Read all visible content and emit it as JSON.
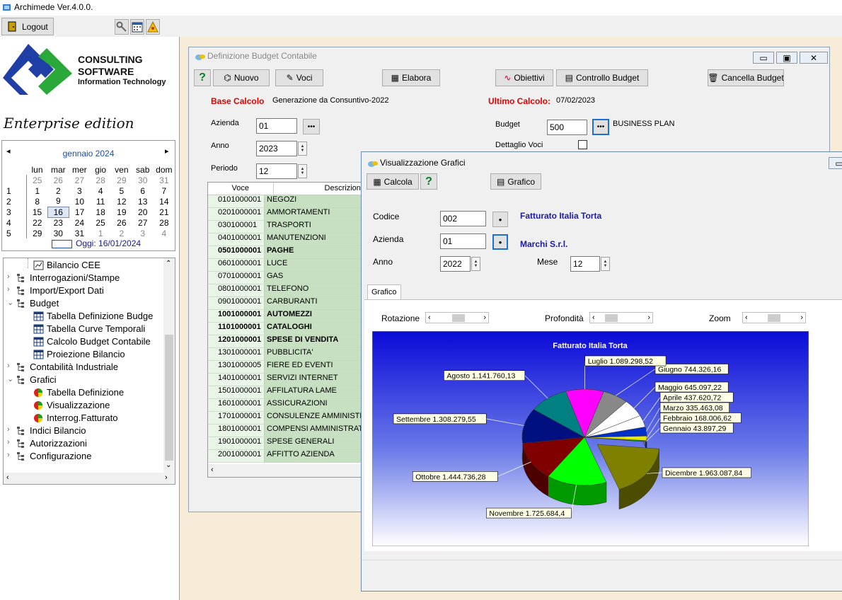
{
  "app": {
    "title": "Archimede Ver.4.0.0.",
    "logout": "Logout"
  },
  "logo": {
    "line1": "CONSULTING",
    "line2": "SOFTWARE",
    "line3": "Information Technology",
    "edition": "Enterprise edition"
  },
  "calendar": {
    "month": "gennaio 2024",
    "weekdays": [
      "lun",
      "mar",
      "mer",
      "gio",
      "ven",
      "sab",
      "dom"
    ],
    "weeks": [
      {
        "wk": "",
        "days": [
          "25",
          "26",
          "27",
          "28",
          "29",
          "30",
          "31"
        ]
      },
      {
        "wk": "1",
        "days": [
          "1",
          "2",
          "3",
          "4",
          "5",
          "6",
          "7"
        ]
      },
      {
        "wk": "2",
        "days": [
          "8",
          "9",
          "10",
          "11",
          "12",
          "13",
          "14"
        ]
      },
      {
        "wk": "3",
        "days": [
          "15",
          "16",
          "17",
          "18",
          "19",
          "20",
          "21"
        ]
      },
      {
        "wk": "4",
        "days": [
          "22",
          "23",
          "24",
          "25",
          "26",
          "27",
          "28"
        ]
      },
      {
        "wk": "5",
        "days": [
          "29",
          "30",
          "31",
          "1",
          "2",
          "3",
          "4"
        ]
      }
    ],
    "today": "Oggi: 16/01/2024"
  },
  "tree": [
    {
      "label": "Bilancio CEE",
      "level": 2,
      "icon": "report-icon"
    },
    {
      "label": "Interrogazioni/Stampe",
      "level": 0,
      "icon": "folder-tree-icon",
      "exp": "›"
    },
    {
      "label": "Import/Export Dati",
      "level": 0,
      "icon": "folder-tree-icon",
      "exp": "›"
    },
    {
      "label": "Budget",
      "level": 0,
      "icon": "folder-tree-icon",
      "exp": "⌄"
    },
    {
      "label": "Tabella Definizione Budge",
      "level": 1,
      "icon": "table-icon"
    },
    {
      "label": "Tabella Curve Temporali",
      "level": 1,
      "icon": "table-icon"
    },
    {
      "label": "Calcolo Budget Contabile",
      "level": 1,
      "icon": "table-icon"
    },
    {
      "label": "Proiezione Bilancio",
      "level": 1,
      "icon": "table-icon"
    },
    {
      "label": "Contabilità Industriale",
      "level": 0,
      "icon": "folder-tree-icon",
      "exp": "›"
    },
    {
      "label": "Grafici",
      "level": 0,
      "icon": "folder-tree-icon",
      "exp": "⌄"
    },
    {
      "label": "Tabella Definizione",
      "level": 1,
      "icon": "pie-chart-icon"
    },
    {
      "label": "Visualizzazione",
      "level": 1,
      "icon": "pie-chart-icon"
    },
    {
      "label": "Interrog.Fatturato",
      "level": 1,
      "icon": "pie-chart-icon"
    },
    {
      "label": "Indici Bilancio",
      "level": 0,
      "icon": "folder-tree-icon",
      "exp": "›"
    },
    {
      "label": "Autorizzazioni",
      "level": 0,
      "icon": "folder-tree-icon",
      "exp": "›"
    },
    {
      "label": "Configurazione",
      "level": 0,
      "icon": "folder-tree-icon",
      "exp": "›"
    }
  ],
  "budget_win": {
    "title": "Definizione Budget Contabile",
    "buttons": {
      "nuovo": "Nuovo",
      "voci": "Voci",
      "elabora": "Elabora",
      "obiettivi": "Obiettivi",
      "controllo": "Controllo Budget",
      "cancella": "Cancella Budget"
    },
    "base_label": "Base Calcolo",
    "base_value": "Generazione da Consuntivo-2022",
    "ultimo_label": "Ultimo Calcolo:",
    "ultimo_value": "07/02/2023",
    "azienda_label": "Azienda",
    "azienda": "01",
    "anno_label": "Anno",
    "anno": "2023",
    "periodo_label": "Periodo",
    "periodo": "12",
    "budget_label": "Budget",
    "budget": "500",
    "budget_desc": "BUSINESS PLAN",
    "dettaglio_label": "Dettaglio Voci",
    "grid_headers": [
      "Voce",
      "Descrizione"
    ],
    "rows": [
      {
        "code": "0101000001",
        "desc": "NEGOZI",
        "bold": false
      },
      {
        "code": "0201000001",
        "desc": "AMMORTAMENTI",
        "bold": false
      },
      {
        "code": "030100001",
        "desc": "TRASPORTI",
        "bold": false
      },
      {
        "code": "0401000001",
        "desc": "MANUTENZIONI",
        "bold": false
      },
      {
        "code": "0501000001",
        "desc": "PAGHE",
        "bold": true
      },
      {
        "code": "0601000001",
        "desc": "LUCE",
        "bold": false
      },
      {
        "code": "0701000001",
        "desc": "GAS",
        "bold": false
      },
      {
        "code": "0801000001",
        "desc": "TELEFONO",
        "bold": false
      },
      {
        "code": "0901000001",
        "desc": "CARBURANTI",
        "bold": false
      },
      {
        "code": "1001000001",
        "desc": "AUTOMEZZI",
        "bold": true
      },
      {
        "code": "1101000001",
        "desc": "CATALOGHI",
        "bold": true
      },
      {
        "code": "1201000001",
        "desc": "SPESE DI VENDITA",
        "bold": true
      },
      {
        "code": "1301000001",
        "desc": "PUBBLICITA'",
        "bold": false
      },
      {
        "code": "1301000005",
        "desc": "FIERE ED EVENTI",
        "bold": false
      },
      {
        "code": "1401000001",
        "desc": "SERVIZI INTERNET",
        "bold": false
      },
      {
        "code": "1501000001",
        "desc": "AFFILATURA LAME",
        "bold": false
      },
      {
        "code": "1601000001",
        "desc": "ASSICURAZIONI",
        "bold": false
      },
      {
        "code": "1701000001",
        "desc": "CONSULENZE AMMINISTR",
        "bold": false
      },
      {
        "code": "1801000001",
        "desc": "COMPENSI AMMINISTRAT",
        "bold": false
      },
      {
        "code": "1901000001",
        "desc": "SPESE GENERALI",
        "bold": false
      },
      {
        "code": "2001000001",
        "desc": "AFFITTO AZIENDA",
        "bold": false
      }
    ]
  },
  "grafici_win": {
    "title": "Visualizzazione Grafici",
    "calcola": "Calcola",
    "grafico_btn": "Grafico",
    "codice_label": "Codice",
    "codice": "002",
    "codice_desc": "Fatturato Italia Torta",
    "azienda_label": "Azienda",
    "azienda": "01",
    "azienda_desc": "Marchi S.r.l.",
    "anno_label": "Anno",
    "anno": "2022",
    "mese_label": "Mese",
    "mese": "12",
    "tab": "Grafico",
    "rotazione": "Rotazione",
    "profondita": "Profondità",
    "zoom": "Zoom"
  },
  "colors": {
    "accent_red": "#e00000",
    "desc_blue": "#1a1aa8"
  },
  "chart_data": {
    "type": "pie",
    "title": "Fatturato Italia Torta",
    "labels": [
      "Gennaio 43.897,29",
      "Febbraio 168.006,62",
      "Marzo 335.463,08",
      "Aprile 437.620,72",
      "Maggio 645.097,22",
      "Giugno 744.326,16",
      "Luglio 1.089.298,52",
      "Agosto 1.141.760,13",
      "Settembre 1.308.279,55",
      "Ottobre 1.444.736,28",
      "Novembre 1.725.684,4",
      "Dicembre 1.963.087,84"
    ],
    "categories": [
      "Gennaio",
      "Febbraio",
      "Marzo",
      "Aprile",
      "Maggio",
      "Giugno",
      "Luglio",
      "Agosto",
      "Settembre",
      "Ottobre",
      "Novembre",
      "Dicembre"
    ],
    "values": [
      43897.29,
      168006.62,
      335463.08,
      437620.72,
      645097.22,
      744326.16,
      1089298.52,
      1141760.13,
      1308279.55,
      1444736.28,
      1725684.4,
      1963087.84
    ],
    "colors": [
      "#00a000",
      "#e8e800",
      "#0030c8",
      "#ffffff",
      "#ffffff",
      "#888888",
      "#ff00ff",
      "#008080",
      "#001080",
      "#800000",
      "#00ff00",
      "#808000"
    ]
  }
}
